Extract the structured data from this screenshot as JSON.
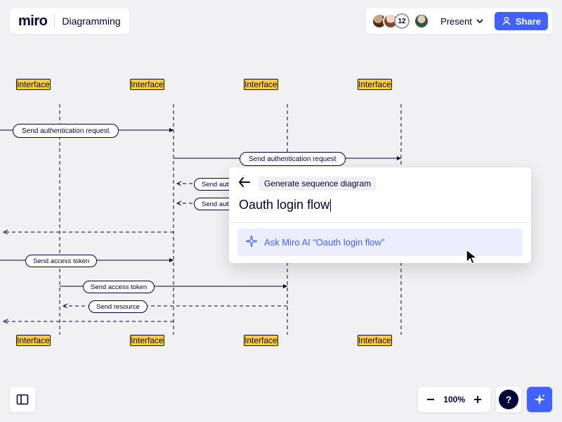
{
  "header": {
    "logo_text": "miro",
    "board_title": "Diagramming",
    "avatar_count": "12",
    "present_label": "Present",
    "share_label": "Share"
  },
  "diagram": {
    "top_lifelines": [
      "Interface",
      "Interface",
      "Interface",
      "Interface"
    ],
    "bottom_lifelines": [
      "Interface",
      "Interface",
      "Interface",
      "Interface"
    ],
    "messages": {
      "m1": "Send authentication request",
      "m2": "Send authentication request",
      "m3": "Send authen",
      "m4": "Send authe",
      "m5": "Send access token",
      "m6": "Send access token",
      "m7": "Send resource"
    }
  },
  "popover": {
    "chip": "Generate sequence diagram",
    "prompt": "Oauth login flow",
    "suggestion": "Ask Miro AI “Oauth login flow”"
  },
  "bottom": {
    "zoom_level": "100%",
    "help_label": "?"
  },
  "icons": {
    "chevron_down": "chevron-down-icon",
    "user": "user-icon",
    "back": "arrow-left-icon",
    "sparkle": "sparkle-icon",
    "frames": "frames-icon",
    "minus": "minus-icon",
    "plus": "plus-icon",
    "ai": "ai-sparkle-icon"
  },
  "colors": {
    "brand_blue": "#4262ff",
    "ink": "#050038",
    "node_yellow": "#ffd02f",
    "canvas_bg": "#f1f1f3",
    "suggest_bg": "#ebeeff"
  }
}
